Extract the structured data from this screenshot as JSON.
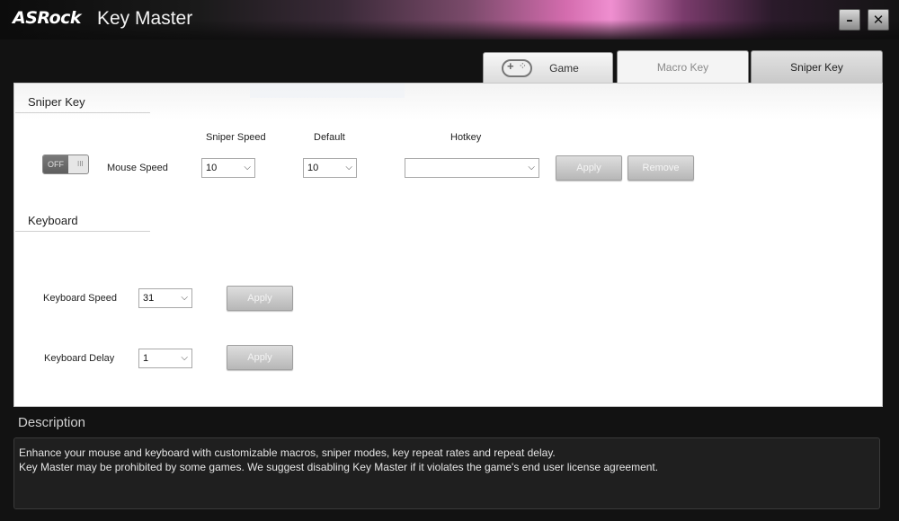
{
  "app": {
    "logo": "ASRock",
    "title": "Key Master",
    "minimize_icon": "minimize-icon",
    "close_icon": "close-icon"
  },
  "tabs": [
    {
      "label": "Game",
      "icon": "gamepad-icon",
      "state": "active"
    },
    {
      "label": "Macro Key",
      "state": "inactive"
    },
    {
      "label": "Sniper Key",
      "state": "inactive"
    }
  ],
  "sniper": {
    "heading": "Sniper Key",
    "toggle_label": "OFF",
    "toggle_grip": "III",
    "row_label": "Mouse Speed",
    "col_sniper_speed": "Sniper Speed",
    "col_default": "Default",
    "col_hotkey": "Hotkey",
    "sniper_speed_value": "10",
    "default_value": "10",
    "hotkey_value": "",
    "apply_label": "Apply",
    "remove_label": "Remove"
  },
  "keyboard": {
    "heading": "Keyboard",
    "speed_label": "Keyboard Speed",
    "speed_value": "31",
    "speed_apply": "Apply",
    "delay_label": "Keyboard Delay",
    "delay_value": "1",
    "delay_apply": "Apply"
  },
  "description": {
    "title": "Description",
    "line1": "Enhance your mouse and keyboard with customizable macros, sniper modes, key repeat rates and repeat delay.",
    "line2": "Key Master may be prohibited by some games. We suggest disabling Key Master if it violates the game's end user license agreement."
  }
}
